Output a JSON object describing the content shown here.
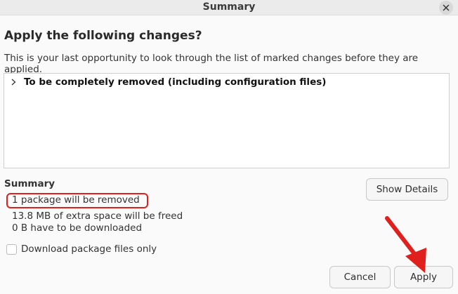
{
  "window": {
    "title": "Summary",
    "close_icon": "close-icon"
  },
  "heading": "Apply the following changes?",
  "subtext": "This is your last opportunity to look through the list of marked changes before they are applied.",
  "tree": {
    "items": [
      {
        "label": "To be completely removed (including configuration files)",
        "expanded": false
      }
    ]
  },
  "summary": {
    "title": "Summary",
    "lines": [
      "1 package will be removed",
      "13.8 MB of extra space will be freed",
      "0  B have to be downloaded"
    ]
  },
  "buttons": {
    "show_details": "Show Details",
    "cancel": "Cancel",
    "apply": "Apply"
  },
  "checkbox": {
    "label": "Download package files only",
    "checked": false
  },
  "annotations": {
    "highlight_color": "#e0201c",
    "arrow_color": "#e0201c"
  }
}
